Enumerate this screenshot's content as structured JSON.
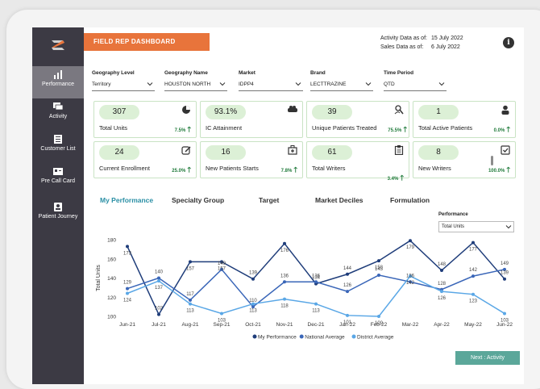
{
  "sidebar": {
    "items": [
      {
        "label": "Performance",
        "icon": "bar-chart-icon",
        "active": true
      },
      {
        "label": "Activity",
        "icon": "chat-icon",
        "active": false
      },
      {
        "label": "Customer List",
        "icon": "list-icon",
        "active": false
      },
      {
        "label": "Pre Call Card",
        "icon": "id-card-icon",
        "active": false
      },
      {
        "label": "Patient Journey",
        "icon": "patient-icon",
        "active": false
      }
    ]
  },
  "header": {
    "title": "FIELD REP DASHBOARD",
    "activity_label": "Activity Data as of:",
    "activity_date": "15 July 2022",
    "sales_label": "Sales Data as of:",
    "sales_date": "6 July 2022",
    "info_icon": "info-icon"
  },
  "filters": [
    {
      "label": "Geography Level",
      "value": "Territory"
    },
    {
      "label": "Geography Name",
      "value": "HOUSTON NORTH"
    },
    {
      "label": "Market",
      "value": "IDPP4"
    },
    {
      "label": "Brand",
      "value": "LECTTRAZINE"
    },
    {
      "label": "Time Period",
      "value": "QTD"
    }
  ],
  "kpis": [
    {
      "value": "307",
      "label": "Total Units",
      "change": "7.5%",
      "icon": "pie-chart-icon"
    },
    {
      "value": "93.1%",
      "label": "IC Attainment",
      "change": "",
      "icon": "handshake-icon"
    },
    {
      "value": "39",
      "label": "Unique Patients Treated",
      "change": "75.5%",
      "icon": "user-search-icon"
    },
    {
      "value": "1",
      "label": "Total Active Patients",
      "change": "0.0%",
      "icon": "person-icon"
    },
    {
      "value": "24",
      "label": "Current Enrollment",
      "change": "25.0%",
      "icon": "edit-icon"
    },
    {
      "value": "16",
      "label": "New Patients Starts",
      "change": "7.8%",
      "icon": "medical-bag-icon"
    },
    {
      "value": "61",
      "label": "Total Writers",
      "change": "3.4%",
      "icon": "clipboard-icon"
    },
    {
      "value": "8",
      "label": "New Writers",
      "change": "100.0%",
      "icon": "checklist-icon"
    }
  ],
  "tabs": [
    "My Performance",
    "Specialty Group",
    "Target",
    "Market Deciles",
    "Formulation"
  ],
  "performance_filter": {
    "label": "Performance",
    "value": "Total Units"
  },
  "chart_data": {
    "type": "line",
    "x": [
      "Jun-21",
      "Jul-21",
      "Aug-21",
      "Sep-21",
      "Oct-21",
      "Nov-21",
      "Dec-21",
      "Jan-22",
      "Feb-22",
      "Mar-22",
      "Apr-22",
      "May-22",
      "Jun-22"
    ],
    "ylabel": "Total Units",
    "ylim": [
      100,
      180
    ],
    "yticks": [
      100,
      120,
      140,
      160,
      180
    ],
    "series": [
      {
        "name": "My Performance",
        "color": "#1f3d7a",
        "values": [
          173,
          102,
          157,
          157,
          139,
          176,
          134,
          144,
          158,
          179,
          148,
          177,
          139
        ]
      },
      {
        "name": "National Average",
        "color": "#3a66b8",
        "values": [
          129,
          140,
          117,
          149,
          110,
          136,
          136,
          126,
          143,
          136,
          128,
          142,
          149
        ]
      },
      {
        "name": "District Average",
        "color": "#5aa7e6",
        "values": [
          124,
          137,
          113,
          103,
          113,
          118,
          113,
          101,
          100,
          142,
          126,
          123,
          103
        ]
      }
    ]
  },
  "next_button": "Next : Activity",
  "colors": {
    "accent": "#e8743b",
    "sidebar": "#3c3a44",
    "kpi_bg": "#dcf0d6",
    "tab_active": "#2a8fa5",
    "button": "#5ba79a"
  }
}
